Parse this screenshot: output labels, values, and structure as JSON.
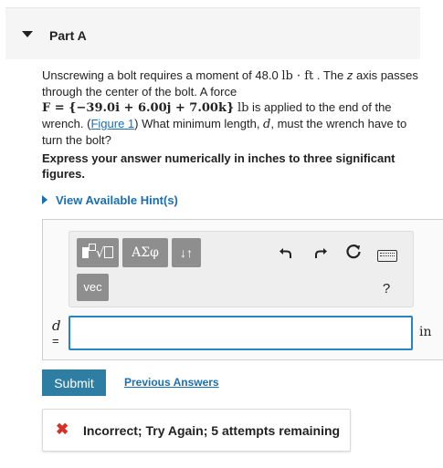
{
  "part": {
    "title": "Part A"
  },
  "question": {
    "t1": "Unscrewing a bolt requires a moment of 48.0 ",
    "unit1": "lb · ft",
    "t2": " . The ",
    "axis": "z",
    "t3": " axis passes through the center of the bolt. A force",
    "force": "F = {−39.0i + 6.00j + 7.00k}",
    "force_unit": "lb",
    "t4": " is applied to the end of the wrench. (",
    "figure_link": "Figure 1",
    "t5": ") What minimum length, ",
    "var": "d",
    "t6": ", must the wrench have to turn the bolt?"
  },
  "instruction": "Express your answer numerically in inches to three significant figures.",
  "hints": {
    "label": "View Available Hint(s)"
  },
  "toolbar": {
    "symbols_label": "ΑΣφ",
    "arrows_label": "↓↑",
    "vec_label": "vec",
    "undo_icon": "undo-icon",
    "redo_icon": "redo-icon",
    "reset_icon": "reset-icon",
    "keyboard_icon": "keyboard-icon",
    "help_label": "?"
  },
  "answer": {
    "var": "d",
    "eq": "=",
    "value": "",
    "unit": "in"
  },
  "actions": {
    "submit_label": "Submit",
    "previous_label": "Previous Answers"
  },
  "feedback": {
    "text": "Incorrect; Try Again; 5 attempts remaining",
    "color": "#d93025"
  }
}
